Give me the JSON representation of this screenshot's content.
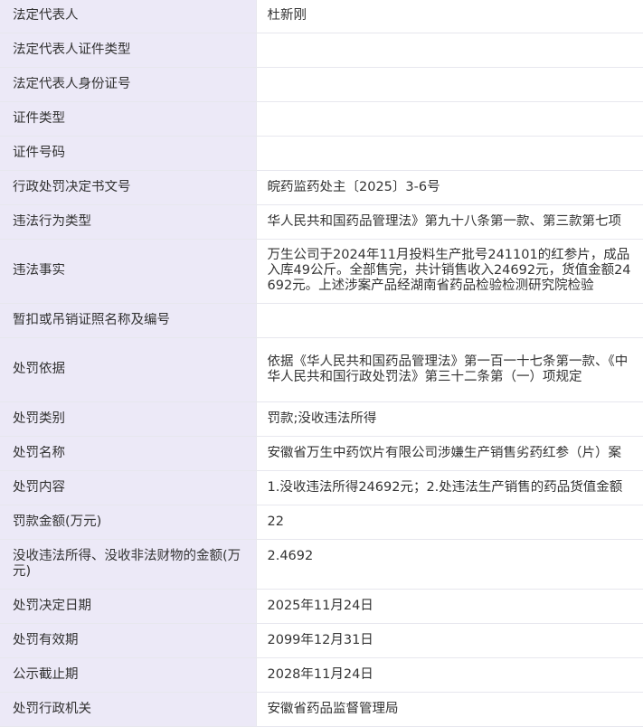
{
  "rows": [
    {
      "label": "法定代表人",
      "value": "杜新刚"
    },
    {
      "label": "法定代表人证件类型",
      "value": ""
    },
    {
      "label": "法定代表人身份证号",
      "value": ""
    },
    {
      "label": "证件类型",
      "value": ""
    },
    {
      "label": "证件号码",
      "value": ""
    },
    {
      "label": "行政处罚决定书文号",
      "value": "皖药监药处主〔2025〕3-6号"
    },
    {
      "label": "违法行为类型",
      "value": "华人民共和国药品管理法》第九十八条第一款、第三款第七项"
    },
    {
      "label": "违法事实",
      "value": "万生公司于2024年11月投料生产批号241101的红参片，成品入库49公斤。全部售完，共计销售收入24692元，货值金额24692元。上述涉案产品经湖南省药品检验检测研究院检验"
    },
    {
      "label": "暂扣或吊销证照名称及编号",
      "value": ""
    },
    {
      "label": "处罚依据",
      "value": "依据《华人民共和国药品管理法》第一百一十七条第一款、《中华人民共和国行政处罚法》第三十二条第（一）项规定"
    },
    {
      "label": "处罚类别",
      "value": "罚款;没收违法所得"
    },
    {
      "label": "处罚名称",
      "value": "安徽省万生中药饮片有限公司涉嫌生产销售劣药红参（片）案"
    },
    {
      "label": "处罚内容",
      "value": "1.没收违法所得24692元；2.处违法生产销售的药品货值金额"
    },
    {
      "label": "罚款金额(万元)",
      "value": "22"
    },
    {
      "label": "没收违法所得、没收非法财物的金额(万元)",
      "value": "2.4692"
    },
    {
      "label": "处罚决定日期",
      "value": "2025年11月24日"
    },
    {
      "label": "处罚有效期",
      "value": "2099年12月31日"
    },
    {
      "label": "公示截止期",
      "value": "2028年11月24日"
    },
    {
      "label": "处罚行政机关",
      "value": "安徽省药品监督管理局"
    }
  ]
}
